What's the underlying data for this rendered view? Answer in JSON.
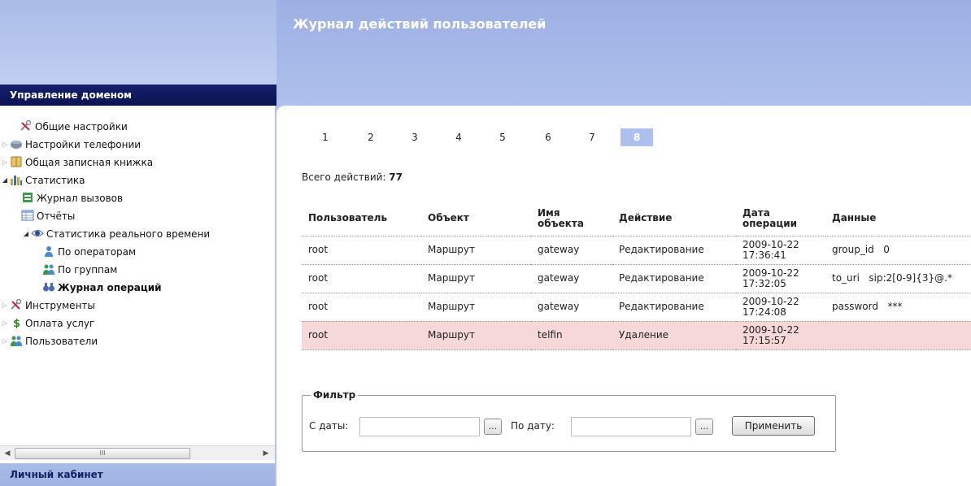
{
  "header": {
    "title": "Журнал действий пользователей"
  },
  "sidebar": {
    "section_title": "Управление доменом",
    "items": [
      {
        "label": "Общие настройки",
        "icon": "tools-icon"
      },
      {
        "label": "Настройки телефонии",
        "icon": "phone-icon"
      },
      {
        "label": "Общая записная книжка",
        "icon": "address-book-icon"
      },
      {
        "label": "Статистика",
        "icon": "statistics-icon"
      },
      {
        "label": "Журнал вызовов",
        "icon": "call-log-icon"
      },
      {
        "label": "Отчёты",
        "icon": "reports-icon"
      },
      {
        "label": "Статистика реального времени",
        "icon": "eye-icon"
      },
      {
        "label": "По операторам",
        "icon": "operator-icon"
      },
      {
        "label": "По группам",
        "icon": "group-icon"
      },
      {
        "label": "Журнал операций",
        "icon": "binoculars-icon"
      },
      {
        "label": "Инструменты",
        "icon": "tools-icon"
      },
      {
        "label": "Оплата услуг",
        "icon": "dollar-icon"
      },
      {
        "label": "Пользователи",
        "icon": "users-icon"
      }
    ],
    "scrollbar_thumb": "III",
    "footer_title": "Личный кабинет"
  },
  "pager": {
    "pages": [
      "1",
      "2",
      "3",
      "4",
      "5",
      "6",
      "7",
      "8"
    ],
    "current": "8"
  },
  "summary": {
    "label": "Всего действий:",
    "count": "77"
  },
  "table": {
    "headers": {
      "user": "Пользователь",
      "object": "Объект",
      "object_name": "Имя объекта",
      "action": "Действие",
      "date": "Дата операции",
      "data": "Данные"
    },
    "rows": [
      {
        "user": "root",
        "object": "Маршрут",
        "object_name": "gateway",
        "action": "Редактирование",
        "date": "2009-10-22",
        "time": "17:36:41",
        "data_key": "group_id",
        "data_value": "0"
      },
      {
        "user": "root",
        "object": "Маршрут",
        "object_name": "gateway",
        "action": "Редактирование",
        "date": "2009-10-22",
        "time": "17:32:05",
        "data_key": "to_uri",
        "data_value": "sip:2[0-9]{3}@.*"
      },
      {
        "user": "root",
        "object": "Маршрут",
        "object_name": "gateway",
        "action": "Редактирование",
        "date": "2009-10-22",
        "time": "17:24:08",
        "data_key": "password",
        "data_value": "***"
      },
      {
        "user": "root",
        "object": "Маршрут",
        "object_name": "telfin",
        "action": "Удаление",
        "date": "2009-10-22",
        "time": "17:15:57",
        "data_key": "",
        "data_value": ""
      }
    ]
  },
  "filter": {
    "legend": "Фильтр",
    "from_label": "С даты:",
    "from_value": "",
    "to_label": "По дату:",
    "to_value": "",
    "picker_label": "...",
    "apply_label": "Применить"
  },
  "colors": {
    "header_gradient": "#a9bbe6",
    "domain_header": "#16206b",
    "active_page": "#aec1ee",
    "deleted_row": "#f6d8d8"
  }
}
